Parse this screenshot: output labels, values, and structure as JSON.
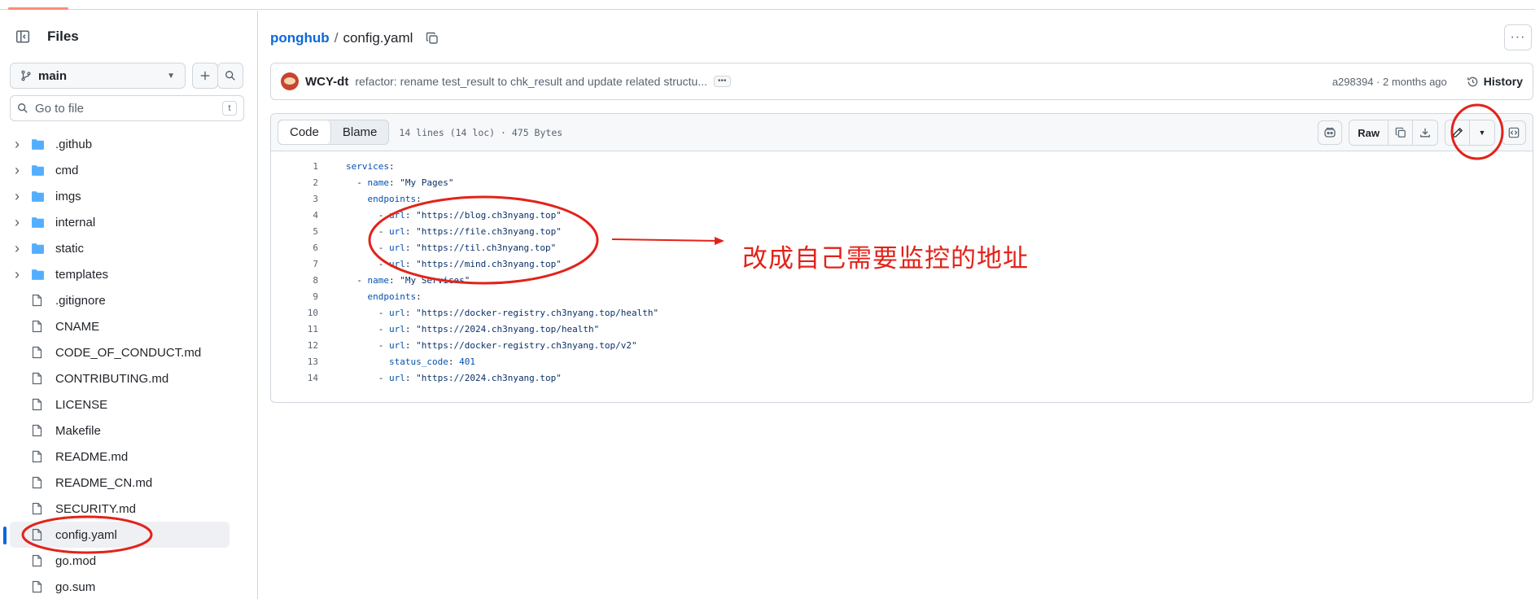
{
  "sidebar": {
    "title": "Files",
    "branch": "main",
    "goto_placeholder": "Go to file",
    "goto_shortcut": "t",
    "items": [
      {
        "type": "dir",
        "label": ".github"
      },
      {
        "type": "dir",
        "label": "cmd"
      },
      {
        "type": "dir",
        "label": "imgs"
      },
      {
        "type": "dir",
        "label": "internal"
      },
      {
        "type": "dir",
        "label": "static"
      },
      {
        "type": "dir",
        "label": "templates"
      },
      {
        "type": "file",
        "label": ".gitignore"
      },
      {
        "type": "file",
        "label": "CNAME"
      },
      {
        "type": "file",
        "label": "CODE_OF_CONDUCT.md"
      },
      {
        "type": "file",
        "label": "CONTRIBUTING.md"
      },
      {
        "type": "file",
        "label": "LICENSE"
      },
      {
        "type": "file",
        "label": "Makefile"
      },
      {
        "type": "file",
        "label": "README.md"
      },
      {
        "type": "file",
        "label": "README_CN.md"
      },
      {
        "type": "file",
        "label": "SECURITY.md"
      },
      {
        "type": "file",
        "label": "config.yaml",
        "selected": true
      },
      {
        "type": "file",
        "label": "go.mod"
      },
      {
        "type": "file",
        "label": "go.sum"
      }
    ]
  },
  "header": {
    "repo": "ponghub",
    "separator": "/",
    "file": "config.yaml"
  },
  "commit": {
    "author": "WCY-dt",
    "message": "refactor: rename test_result to chk_result and update related structu...",
    "meta": "a298394 · 2 months ago",
    "history_label": "History"
  },
  "code_view": {
    "tab_code": "Code",
    "tab_blame": "Blame",
    "stats": "14 lines (14 loc) · 475 Bytes",
    "raw_label": "Raw",
    "lines": [
      {
        "n": "1",
        "html": "<span class='k'>services</span>:"
      },
      {
        "n": "2",
        "html": "  - <span class='k'>name</span>: <span class='s'>\"My Pages\"</span>"
      },
      {
        "n": "3",
        "html": "    <span class='k'>endpoints</span>:"
      },
      {
        "n": "4",
        "html": "      - <span class='k'>url</span>: <span class='s'>\"https://blog.ch3nyang.top\"</span>"
      },
      {
        "n": "5",
        "html": "      - <span class='k'>url</span>: <span class='s'>\"https://file.ch3nyang.top\"</span>"
      },
      {
        "n": "6",
        "html": "      - <span class='k'>url</span>: <span class='s'>\"https://til.ch3nyang.top\"</span>"
      },
      {
        "n": "7",
        "html": "      - <span class='k'>url</span>: <span class='s'>\"https://mind.ch3nyang.top\"</span>"
      },
      {
        "n": "8",
        "html": "  - <span class='k'>name</span>: <span class='s'>\"My Services\"</span>"
      },
      {
        "n": "9",
        "html": "    <span class='k'>endpoints</span>:"
      },
      {
        "n": "10",
        "html": "      - <span class='k'>url</span>: <span class='s'>\"https://docker-registry.ch3nyang.top/health\"</span>"
      },
      {
        "n": "11",
        "html": "      - <span class='k'>url</span>: <span class='s'>\"https://2024.ch3nyang.top/health\"</span>"
      },
      {
        "n": "12",
        "html": "      - <span class='k'>url</span>: <span class='s'>\"https://docker-registry.ch3nyang.top/v2\"</span>"
      },
      {
        "n": "13",
        "html": "        <span class='k'>status_code</span>: <span class='n'>401</span>"
      },
      {
        "n": "14",
        "html": "      - <span class='k'>url</span>: <span class='s'>\"https://2024.ch3nyang.top\"</span>"
      }
    ]
  },
  "annotation": {
    "text": "改成自己需要监控的地址",
    "color": "#e2231a"
  },
  "colors": {
    "link": "#0969da",
    "muted": "#59636e",
    "border": "#d0d7de",
    "annotation_red": "#e2231a"
  }
}
